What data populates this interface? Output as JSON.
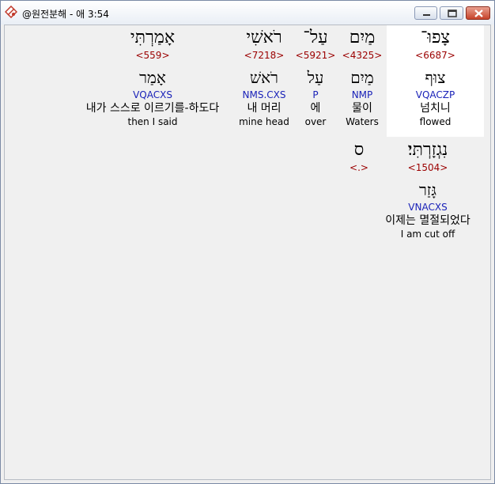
{
  "window": {
    "title": "@원전분해 - 애 3:54"
  },
  "words": [
    {
      "hebrew": "צָפוּ־",
      "strong": "<6687>",
      "lemma": "צוּף",
      "morph": "VQACZP",
      "korean": "넘치니",
      "english": "flowed"
    },
    {
      "hebrew": "מַיִם",
      "strong": "<4325>",
      "lemma": "מַיִם",
      "morph": "NMP",
      "korean": "물이",
      "english": "Waters"
    },
    {
      "hebrew": "עַל־",
      "strong": "<5921>",
      "lemma": "עַל",
      "morph": "P",
      "korean": "에",
      "english": "over"
    },
    {
      "hebrew": "רֹאשִׁי",
      "strong": "<7218>",
      "lemma": "רֹאשׁ",
      "morph": "NMS.CXS",
      "korean": "내 머리",
      "english": "mine head"
    },
    {
      "hebrew": "אָמַרְתִּי",
      "strong": "<559>",
      "lemma": "אָמַר",
      "morph": "VQACXS",
      "korean": "내가 스스로 이르기를-하도다",
      "english": "then I said"
    },
    {
      "hebrew": "נִגְזָרְתִּי׃",
      "strong": "<1504>",
      "lemma": "גָּזַר",
      "morph": "VNACXS",
      "korean": "이제는 멸절되었다",
      "english": "I am cut off"
    },
    {
      "hebrew": "ס",
      "strong": "<.>",
      "lemma": "",
      "morph": "",
      "korean": "",
      "english": ""
    }
  ]
}
